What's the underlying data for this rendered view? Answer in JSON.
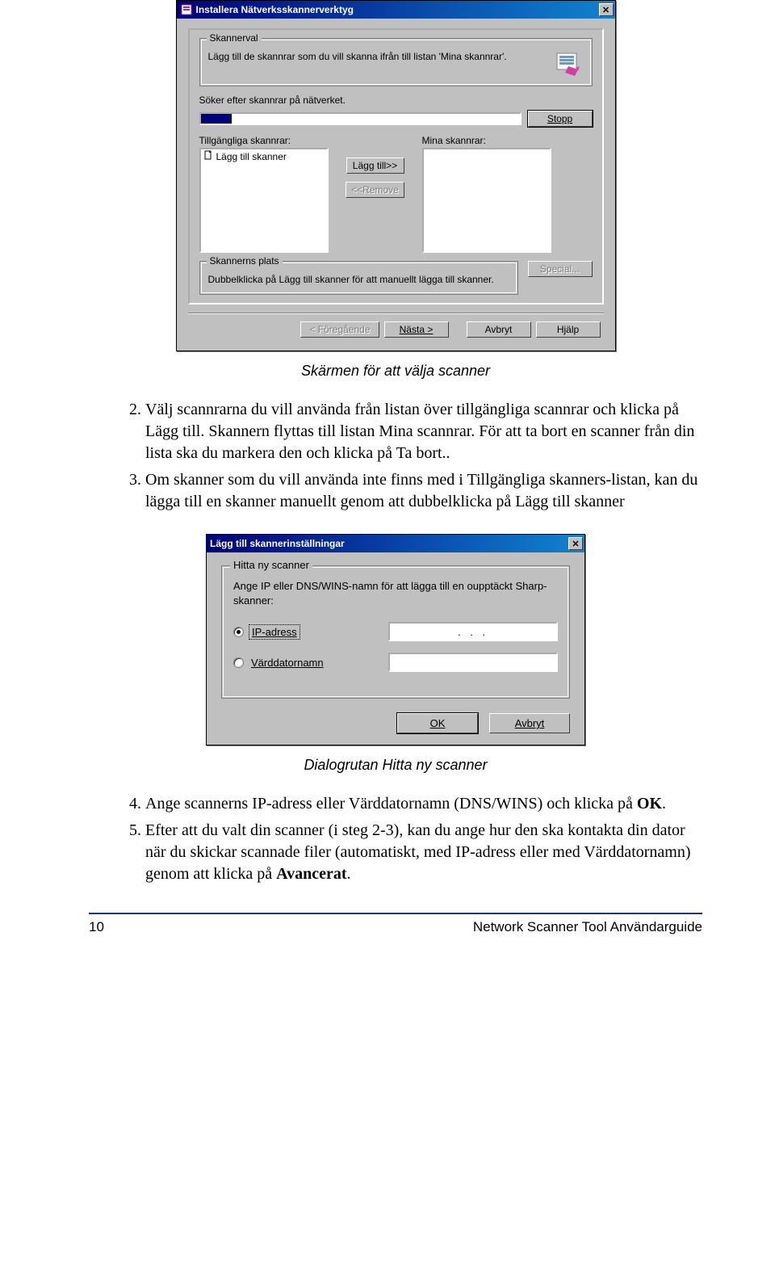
{
  "dialog1": {
    "title": "Installera Nätverksskannerverktyg",
    "group_skannerval": {
      "label": "Skannerval",
      "text": "Lägg till de skannrar som du vill skanna ifrån till listan 'Mina skannrar'."
    },
    "search_label": "Söker efter skannrar på nätverket.",
    "stop_button": "Stopp",
    "available_label": "Tillgängliga skannrar:",
    "my_label": "Mina skannrar:",
    "available_item": "Lägg till skanner",
    "add_button": "Lägg till>>",
    "remove_button": "<<Remove",
    "place_group": {
      "label": "Skannerns plats",
      "text": "Dubbelklicka på Lägg till skanner för att manuellt lägga till skanner."
    },
    "special_button": "Special...",
    "prev_button": "< Föregående",
    "next_button": "Nästa >",
    "cancel_button": "Avbryt",
    "help_button": "Hjälp"
  },
  "caption1": "Skärmen för att välja scanner",
  "list1": {
    "item2": "Välj scannrarna du vill använda från listan över tillgängliga scannrar och klicka på Lägg till. Skannern flyttas till listan Mina scannrar. För att ta bort en scanner från din lista ska du markera den och klicka på Ta bort..",
    "item3": "Om skanner som du vill använda inte finns med i Tillgängliga skanners-listan, kan du lägga till en skanner manuellt genom att dubbelklicka på Lägg till skanner"
  },
  "dialog2": {
    "title": "Lägg till skannerinställningar",
    "group_label": "Hitta ny scanner",
    "desc": "Ange IP eller DNS/WINS-namn för att lägga till en oupptäckt Sharp-skanner:",
    "radio_ip": "IP-adress",
    "radio_host": "Värddatornamn",
    "ip_dots": ".      .      .",
    "ok": "OK",
    "cancel": "Avbryt"
  },
  "caption2": "Dialogrutan Hitta ny scanner",
  "list2": {
    "item4_pre": "Ange scannerns IP-adress eller Värddatornamn (DNS/WINS) och klicka på ",
    "item4_ok": "OK",
    "item4_post": ".",
    "item5_pre": "Efter att du valt din scanner (i steg 2-3), kan du ange hur den ska kontakta din dator när du skickar scannade filer (automatiskt, med IP-adress eller med Värddatornamn) genom att klicka på ",
    "item5_adv": "Avancerat",
    "item5_post": "."
  },
  "footer": {
    "page": "10",
    "title": "Network Scanner Tool Användarguide"
  }
}
